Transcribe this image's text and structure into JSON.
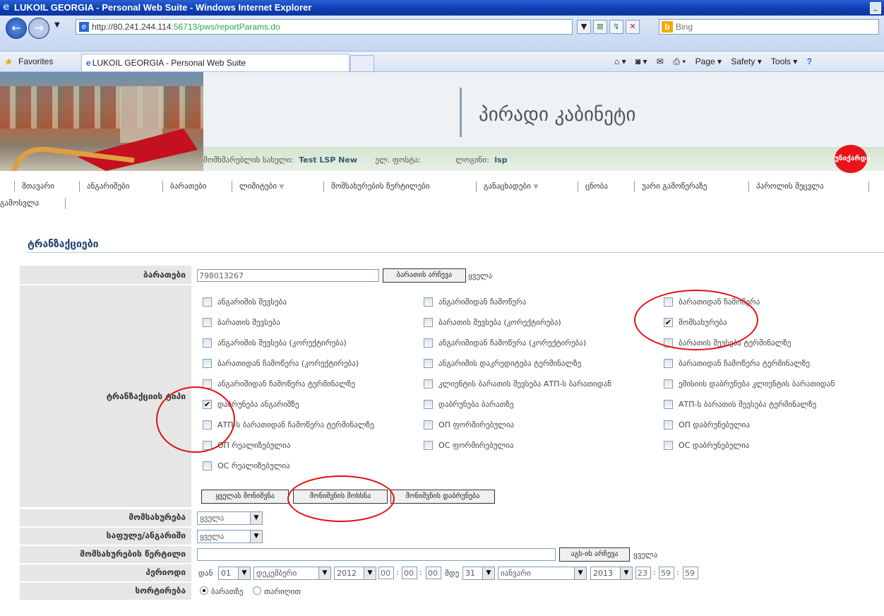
{
  "browser": {
    "title": "LUKOIL GEORGIA - Personal Web Suite - Windows Internet Explorer",
    "url_host": "http://80.241.244.114",
    "url_path": ":56713/pws/reportParams.do",
    "search_placeholder": "Bing",
    "favorites_label": "Favorites",
    "tab_title": "LUKOIL GEORGIA - Personal Web Suite",
    "tools": [
      "Page ▾",
      "Safety ▾",
      "Tools ▾"
    ]
  },
  "header": {
    "cabinet_title": "პირადი კაბინეტი",
    "user_label": "მომხმარებლის სახელი:",
    "user_value": "Test LSP New",
    "email_label": "ელ. ფოსტა:",
    "login_label": "ლოგინი:",
    "login_value": "lsp",
    "logo_text": "უნიქარდი"
  },
  "menu": {
    "row1": [
      "მთავარი",
      "ანგარიშები",
      "ბარათები",
      "ლიმიტები",
      "მომსახურების წერტილები",
      "განაცხადები",
      "ცნობა",
      "უარი გამოწერაზე",
      "პაროლის შეცვლა"
    ],
    "row2": [
      "გამოსვლა"
    ]
  },
  "section_title": "ტრანზაქციები",
  "form": {
    "cards_label": "ბარათები",
    "card_value": "798013267",
    "card_select_btn": "ბარათის არჩევა",
    "all_text": "ყველა",
    "tx_type_label": "ტრანზაქციის ტიპი",
    "tx_types": [
      {
        "label": "ანგარიშის შევსება",
        "checked": false
      },
      {
        "label": "ანგარიშიდან ჩამოწერა",
        "checked": false
      },
      {
        "label": "ბარათიდან ჩამოწერა",
        "checked": false
      },
      {
        "label": "ბარათის შევსება",
        "checked": false
      },
      {
        "label": "ბარათის შევსება (კორექტირება)",
        "checked": false
      },
      {
        "label": "მომსახურება",
        "checked": true
      },
      {
        "label": "ანგარიშის შევსება (კორექტირება)",
        "checked": false
      },
      {
        "label": "ანგარიშიდან ჩამოწერა (კორექტირება)",
        "checked": false
      },
      {
        "label": "ბარათის შევსება ტერმინალზე",
        "checked": false
      },
      {
        "label": "ბარათიდან ჩამოწერა (კორექტირება)",
        "checked": false
      },
      {
        "label": "ანგარიშის დაკრედიტება ტერმინალზე",
        "checked": false
      },
      {
        "label": "ბარათიდან ჩამოწერა ტერმინალზე",
        "checked": false
      },
      {
        "label": "ანგარიშიდან ჩამოწერა ტერმინალზე",
        "checked": false
      },
      {
        "label": "კლიენტის ბარათის შევსება АТП-ს ბარათიდან",
        "checked": false
      },
      {
        "label": "ემისიის დაბრუნება კლიენტის ბარათიდან",
        "checked": false
      },
      {
        "label": "დაბრუნება ანგარიშზე",
        "checked": true
      },
      {
        "label": "დაბრუნება ბარათზე",
        "checked": false
      },
      {
        "label": "АТП-ს ბარათის შევსება ტერმინალზე",
        "checked": false
      },
      {
        "label": "АТП-ს ბარათიდან ჩამოწერა ტერმინალზე",
        "checked": false
      },
      {
        "label": "ОП ფორმირებულია",
        "checked": false
      },
      {
        "label": "ОП დაბრუნებულია",
        "checked": false
      },
      {
        "label": "ОП რეალიზებულია",
        "checked": false
      },
      {
        "label": "ОС ფორმირებულია",
        "checked": false
      },
      {
        "label": "ОС დაბრუნებულია",
        "checked": false
      },
      {
        "label": "ОС რეალიზებულია",
        "checked": false
      }
    ],
    "select_all_btn": "ყველას მონიშვნა",
    "clear_btn": "მონიშვნის მოხსნა",
    "restore_btn": "მონიშვნის დაბრუნება",
    "service_label": "მომსახურება",
    "service_value": "ყველა",
    "wallet_label": "საფულე/ანგარიში",
    "wallet_value": "ყველა",
    "point_label": "მომსახურების წერტილი",
    "point_select_btn": "აგს-ის არჩევა",
    "period_label": "პერიოდი",
    "from_text": "დან",
    "to_text": "მდე",
    "from": {
      "day": "01",
      "month": "დეკემბერი",
      "year": "2012",
      "h": "00",
      "m": "00",
      "s": "00"
    },
    "to": {
      "day": "31",
      "month": "იანვარი",
      "year": "2013",
      "h": "23",
      "m": "59",
      "s": "59"
    },
    "sort_label": "სორტირება",
    "sort_opt1": "ბარათზე",
    "sort_opt2": "თარიღით"
  },
  "colors": {
    "annotation": "#e01010",
    "title_blue": "#1c3f6e",
    "label_bg": "#e6e6e6"
  }
}
